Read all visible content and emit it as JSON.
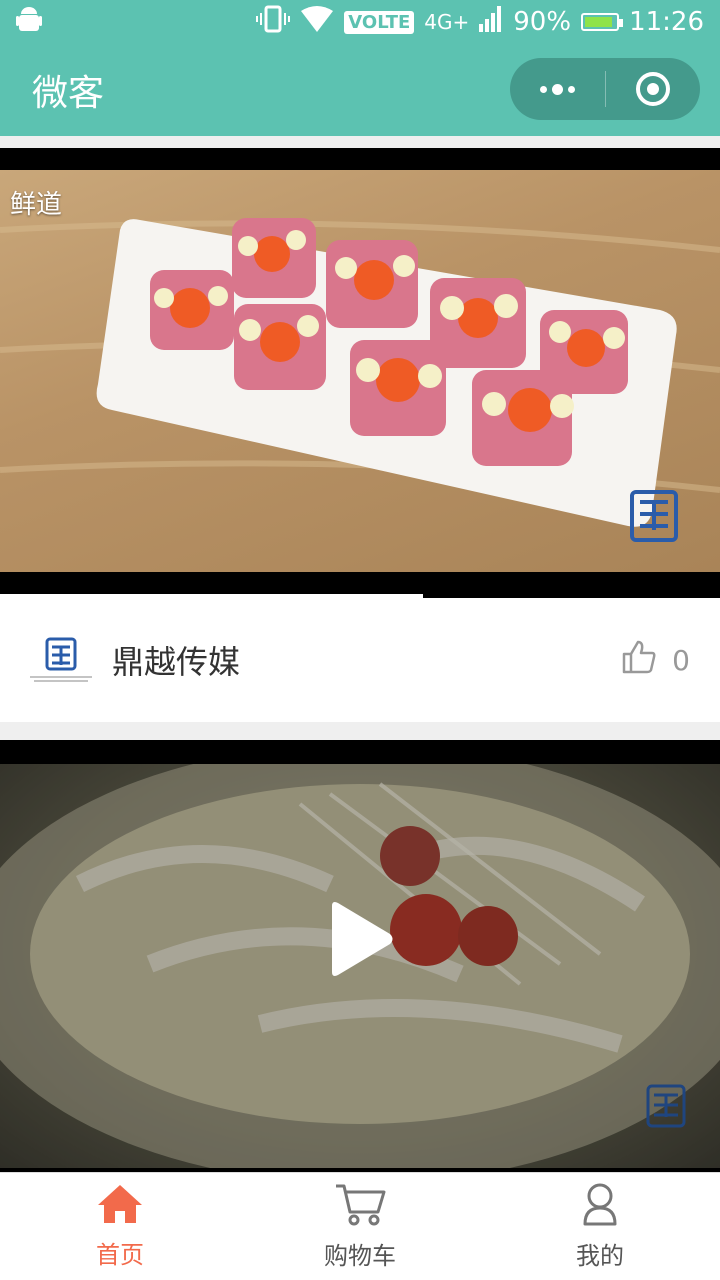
{
  "status_bar": {
    "network": "4G+",
    "volte": "VOLTE",
    "battery": "90%",
    "battery_level": 0.9,
    "time": "11:26",
    "icons": [
      "android-icon",
      "vibrate-icon",
      "wifi-icon",
      "signal-icon",
      "battery-icon"
    ]
  },
  "nav": {
    "title": "微客",
    "more_icon": "more-dots-icon",
    "close_icon": "target-icon"
  },
  "feed": [
    {
      "corner_tag": "鲜道",
      "progress": 0.588,
      "author": "鼎越传媒",
      "likes": "0",
      "like_icon": "thumbs-up-icon"
    },
    {
      "state": "paused",
      "play_icon": "play-icon"
    }
  ],
  "tabbar": {
    "items": [
      {
        "label": "首页",
        "icon": "home-icon",
        "active": true
      },
      {
        "label": "购物车",
        "icon": "cart-icon",
        "active": false
      },
      {
        "label": "我的",
        "icon": "user-icon",
        "active": false
      }
    ]
  },
  "colors": {
    "theme": "#5cc2b1",
    "capsule": "#449a8c",
    "active_tab": "#f26a4b"
  }
}
